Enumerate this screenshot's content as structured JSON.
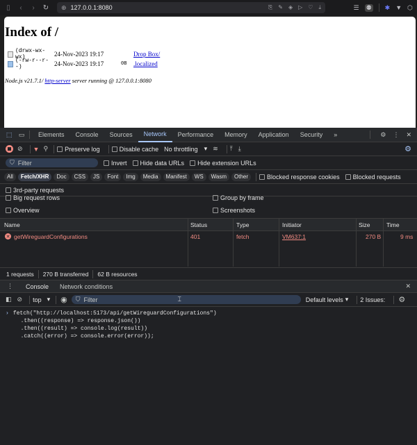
{
  "browser": {
    "url": "127.0.0.1:8080"
  },
  "page": {
    "heading": "Index of /",
    "listing": [
      {
        "perm": "(drwx-wx-wx)",
        "date": "24-Nov-2023 19:17",
        "size": "",
        "name": "Drop Box/"
      },
      {
        "perm": "(-rw-r--r--)",
        "date": "24-Nov-2023 19:17",
        "size": "0B",
        "name": ".localized"
      }
    ],
    "footer_prefix": "Node.js v21.7.1/ ",
    "footer_link": "http-server",
    "footer_suffix": " server running @ 127.0.0.1:8080"
  },
  "devtools": {
    "tabs": [
      "Elements",
      "Console",
      "Sources",
      "Network",
      "Performance",
      "Memory",
      "Application",
      "Security"
    ],
    "active_tab": "Network",
    "toolbar": {
      "preserve_log": "Preserve log",
      "disable_cache": "Disable cache",
      "throttling": "No throttling"
    },
    "filter": {
      "placeholder": "Filter",
      "invert": "Invert",
      "hide_data_urls": "Hide data URLs",
      "hide_extension_urls": "Hide extension URLs"
    },
    "type_chips": [
      "All",
      "Fetch/XHR",
      "Doc",
      "CSS",
      "JS",
      "Font",
      "Img",
      "Media",
      "Manifest",
      "WS",
      "Wasm",
      "Other"
    ],
    "active_chip": "Fetch/XHR",
    "blocked_response_cookies": "Blocked response cookies",
    "blocked_requests": "Blocked requests",
    "third_party": "3rd-party requests",
    "options": {
      "big_request_rows": "Big request rows",
      "group_by_frame": "Group by frame",
      "overview": "Overview",
      "screenshots": "Screenshots"
    },
    "table": {
      "headers": [
        "Name",
        "Status",
        "Type",
        "Initiator",
        "Size",
        "Time"
      ],
      "rows": [
        {
          "name": "getWireguardConfigurations",
          "status": "401",
          "type": "fetch",
          "initiator": "VM637:1",
          "size": "270 B",
          "time": "9 ms"
        }
      ]
    },
    "status": {
      "requests": "1 requests",
      "transferred": "270 B transferred",
      "resources": "62 B resources"
    },
    "drawer_tabs": [
      "Console",
      "Network conditions"
    ],
    "console_toolbar": {
      "context": "top",
      "filter_placeholder": "Filter",
      "levels": "Default levels",
      "issues": "2 Issues:"
    },
    "console_lines": [
      "fetch(\"http://localhost:5173/api/getWireguardConfigurations\")",
      "  .then((response) => response.json())",
      "  .then((result) => console.log(result))",
      "  .catch((error) => console.error(error));"
    ]
  },
  "colors": {
    "accent": "#a8c7fa",
    "error": "#f28b82",
    "link": "#0000cc"
  }
}
